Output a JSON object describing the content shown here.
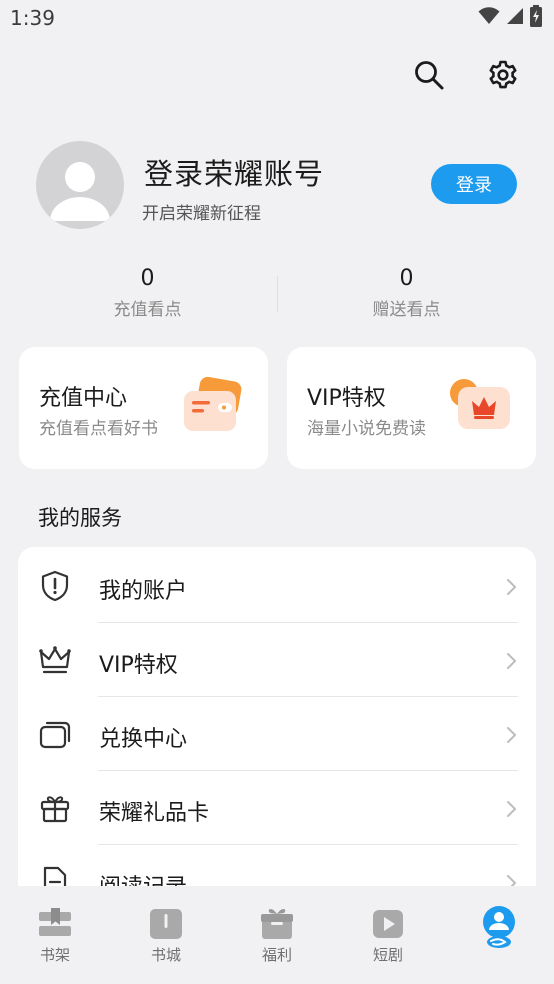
{
  "status": {
    "time": "1:39"
  },
  "profile": {
    "title": "登录荣耀账号",
    "subtitle": "开启荣耀新征程",
    "login_label": "登录"
  },
  "stats": [
    {
      "value": "0",
      "label": "充值看点"
    },
    {
      "value": "0",
      "label": "赠送看点"
    }
  ],
  "cards": [
    {
      "title": "充值中心",
      "subtitle": "充值看点看好书"
    },
    {
      "title": "VIP特权",
      "subtitle": "海量小说免费读"
    }
  ],
  "services": {
    "title": "我的服务",
    "items": [
      {
        "label": "我的账户",
        "icon": "shield-alert-icon"
      },
      {
        "label": "VIP特权",
        "icon": "crown-icon"
      },
      {
        "label": "兑换中心",
        "icon": "cards-icon"
      },
      {
        "label": "荣耀礼品卡",
        "icon": "gift-box-icon"
      },
      {
        "label": "阅读记录",
        "icon": "document-icon"
      }
    ]
  },
  "tabs": [
    {
      "label": "书架",
      "icon": "bookshelf-icon"
    },
    {
      "label": "书城",
      "icon": "book-store-icon"
    },
    {
      "label": "福利",
      "icon": "gift-icon"
    },
    {
      "label": "短剧",
      "icon": "play-icon"
    },
    {
      "label": "",
      "icon": "profile-icon",
      "active": true
    }
  ],
  "colors": {
    "accent": "#1c9bef",
    "background": "#f1f1f3",
    "card": "#ffffff",
    "tab_inactive": "#aaaaaa"
  }
}
